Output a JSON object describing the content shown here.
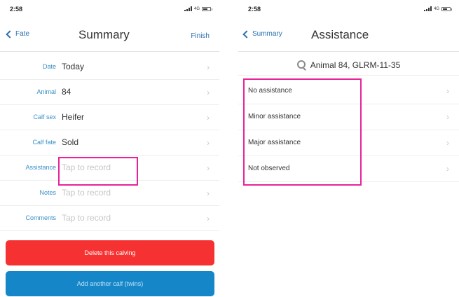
{
  "left_screen": {
    "status": {
      "time": "2:58",
      "network": "4G"
    },
    "nav": {
      "back_label": "Fate",
      "title": "Summary",
      "finish_label": "Finish"
    },
    "rows": [
      {
        "label": "Date",
        "value": "Today",
        "placeholder": false
      },
      {
        "label": "Animal",
        "value": "84",
        "placeholder": false
      },
      {
        "label": "Calf sex",
        "value": "Heifer",
        "placeholder": false
      },
      {
        "label": "Calf fate",
        "value": "Sold",
        "placeholder": false
      },
      {
        "label": "Assistance",
        "value": "Tap to record",
        "placeholder": true
      },
      {
        "label": "Notes",
        "value": "Tap to record",
        "placeholder": true
      },
      {
        "label": "Comments",
        "value": "Tap to record",
        "placeholder": true
      }
    ],
    "delete_button": "Delete this calving",
    "add_button": "Add another calf (twins)",
    "colors": {
      "delete": "#f53131",
      "add": "#1587c9",
      "accent": "#2a6fb0"
    }
  },
  "right_screen": {
    "status": {
      "time": "2:58",
      "network": "4G"
    },
    "nav": {
      "back_label": "Summary",
      "title": "Assistance"
    },
    "search_label": "Animal 84, GLRM-11-35",
    "options": [
      {
        "label": "No assistance"
      },
      {
        "label": "Minor assistance"
      },
      {
        "label": "Major assistance"
      },
      {
        "label": "Not observed"
      }
    ]
  },
  "highlight_color": "#e8239a",
  "icons": {
    "back": "chevron-left-icon",
    "disclosure": "chevron-right-icon",
    "search": "search-icon"
  }
}
